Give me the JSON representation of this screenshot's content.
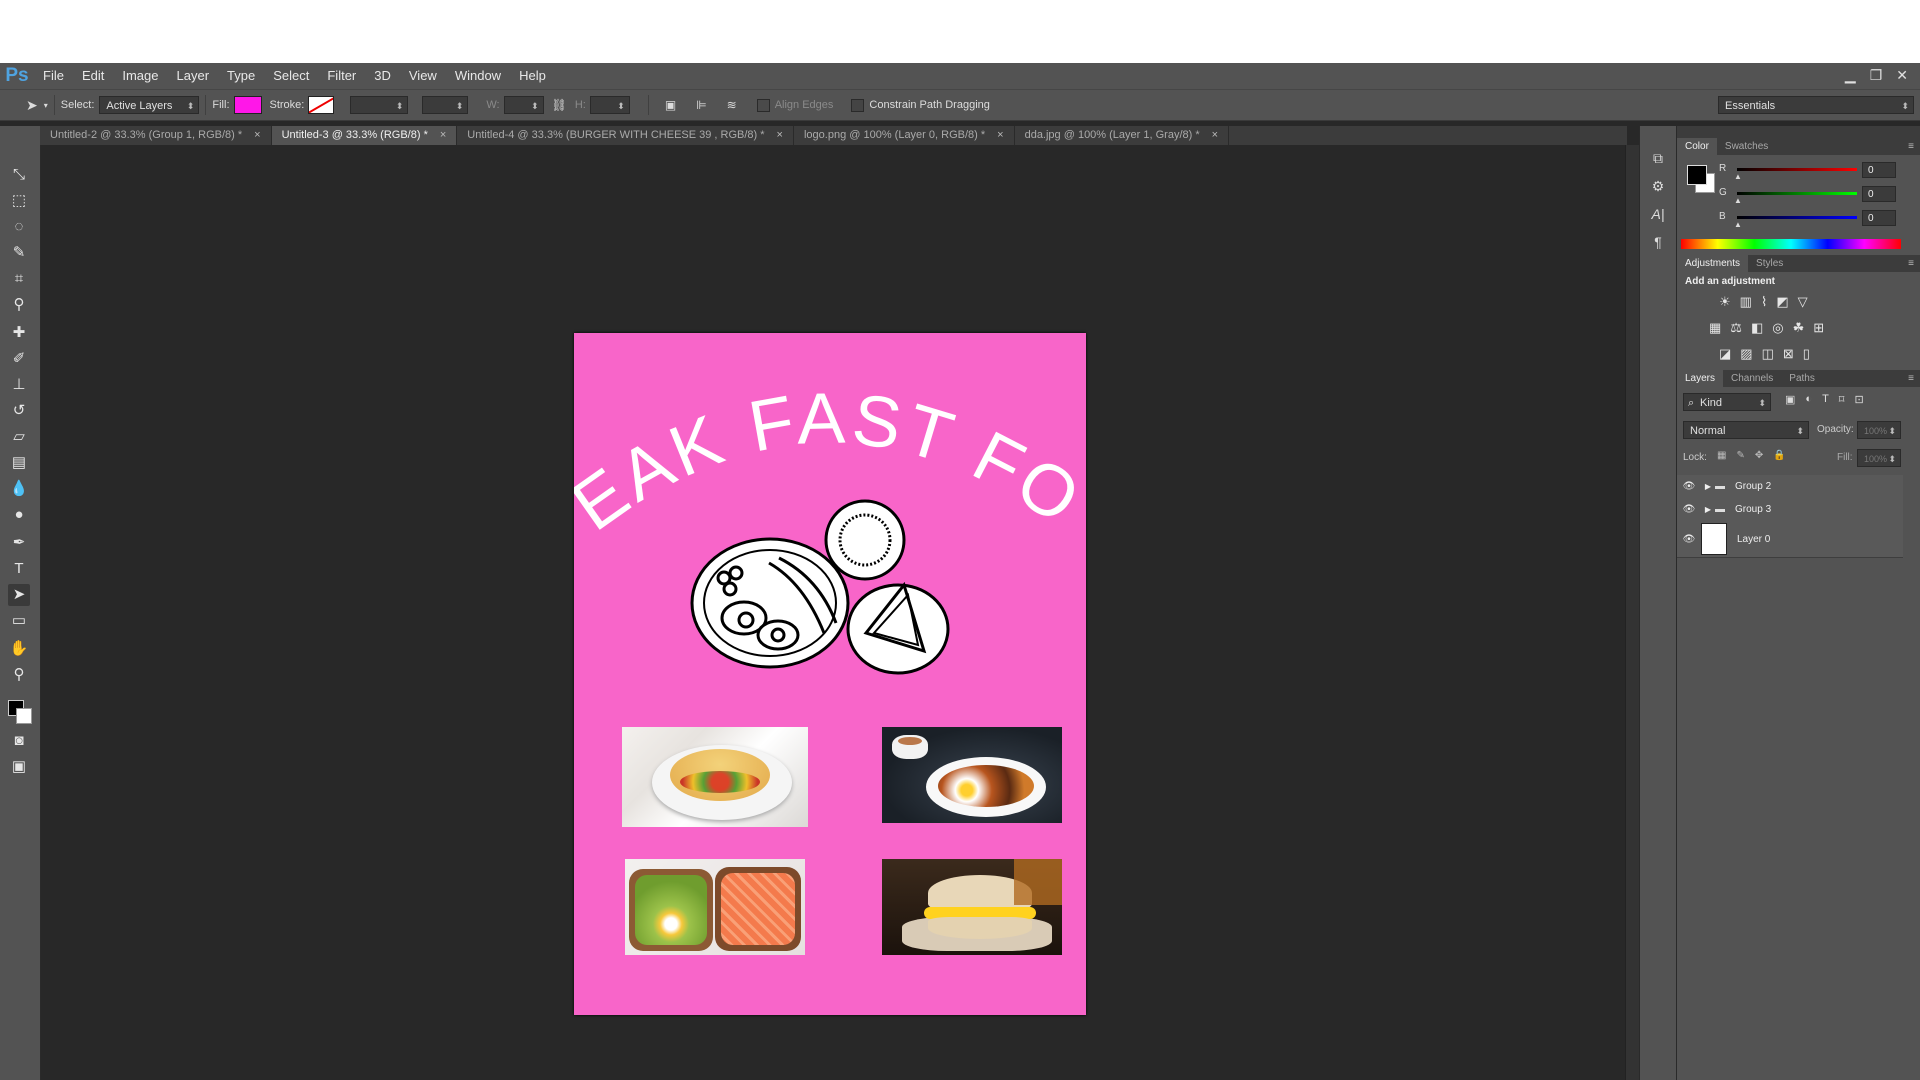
{
  "app": {
    "logo": "Ps"
  },
  "menu": [
    "File",
    "Edit",
    "Image",
    "Layer",
    "Type",
    "Select",
    "Filter",
    "3D",
    "View",
    "Window",
    "Help"
  ],
  "window_controls": [
    "▁",
    "❐",
    "✕"
  ],
  "options": {
    "select_label": "Select:",
    "select_value": "Active Layers",
    "fill_label": "Fill:",
    "fill_color": "#ff17e8",
    "stroke_label": "Stroke:",
    "w_label": "W:",
    "h_label": "H:",
    "align_edges": "Align Edges",
    "constrain": "Constrain Path Dragging",
    "workspace": "Essentials"
  },
  "tabs": [
    {
      "label": "Untitled-2 @ 33.3% (Group 1, RGB/8) *",
      "active": false
    },
    {
      "label": "Untitled-3 @ 33.3% (RGB/8) *",
      "active": true
    },
    {
      "label": "Untitled-4 @ 33.3% (BURGER WITH CHEESE 39 , RGB/8) *",
      "active": false
    },
    {
      "label": "logo.png @ 100% (Layer 0, RGB/8) *",
      "active": false
    },
    {
      "label": "dda.jpg @ 100% (Layer 1, Gray/8) *",
      "active": false
    }
  ],
  "tab_close": "×",
  "document": {
    "title": "BREAK FAST FOOD",
    "background": "#f865c9"
  },
  "color_panel": {
    "tabs": [
      "Color",
      "Swatches"
    ],
    "channels": [
      {
        "label": "R",
        "value": "0"
      },
      {
        "label": "G",
        "value": "0"
      },
      {
        "label": "B",
        "value": "0"
      }
    ]
  },
  "adjustments_panel": {
    "tabs": [
      "Adjustments",
      "Styles"
    ],
    "heading": "Add an adjustment"
  },
  "layers_panel": {
    "tabs": [
      "Layers",
      "Channels",
      "Paths"
    ],
    "kind": "Kind",
    "blend_mode": "Normal",
    "opacity_label": "Opacity:",
    "opacity_value": "100%",
    "lock_label": "Lock:",
    "fill_label": "Fill:",
    "fill_value": "100%",
    "layers": [
      {
        "name": "Group 2",
        "type": "group"
      },
      {
        "name": "Group 3",
        "type": "group"
      },
      {
        "name": "Layer 0",
        "type": "layer"
      }
    ]
  }
}
